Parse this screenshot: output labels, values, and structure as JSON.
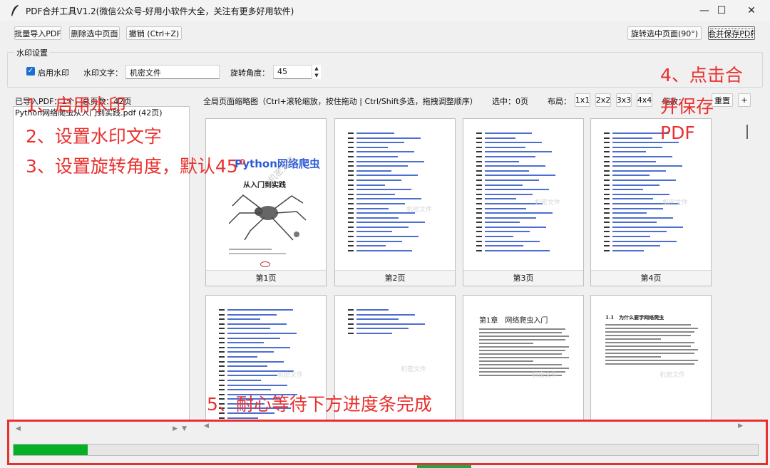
{
  "window": {
    "title": "PDF合并工具V1.2(微信公众号-好用小软件大全，关注有更多好用软件)",
    "minimize": "—",
    "maximize": "☐",
    "close": "✕"
  },
  "toolbar": {
    "import": "批量导入PDF",
    "delete": "删除选中页面",
    "undo": "撤销 (Ctrl+Z)",
    "rotate": "旋转选中页面(90°)",
    "merge_save": "合并保存PDF"
  },
  "watermark": {
    "group_title": "水印设置",
    "enable_label": "启用水印",
    "enabled": true,
    "text_label": "水印文字：",
    "text_value": "机密文件",
    "angle_label": "旋转角度：",
    "angle_value": "45"
  },
  "files": {
    "summary": "已导入PDF：1个，总页数：42页",
    "items": [
      "Python网络爬虫从入门到实践.pdf (42页)"
    ]
  },
  "preview": {
    "hint": "全局页面缩略图（Ctrl+滚轮缩放，按住拖动 | Ctrl/Shift多选，拖拽调整顺序）",
    "selected": "选中：0页",
    "layout_label": "布局：",
    "layouts": [
      "1x1",
      "2x2",
      "3x3",
      "4x4"
    ],
    "zoom_label": "缩放：",
    "zoom_reset": "重置",
    "zoom_plus": "+",
    "pages": [
      "第1页",
      "第2页",
      "第3页",
      "第4页"
    ],
    "cover_title": "Python网络爬虫",
    "cover_subtitle": "从入门到实践",
    "watermark_text": "机密文件",
    "chapter_title": "第1章　网络爬虫入门",
    "section_title": "1.1　为什么要学网络爬虫"
  },
  "progress": {
    "value": 0.1
  },
  "annotations": {
    "a1": "1、启用水印",
    "a2": "2、设置水印文字",
    "a3": "3、设置旋转角度，默认45°",
    "a4_line1": "4、点击合",
    "a4_line2": "并保存",
    "a4_line3": "PDF",
    "a5": "5、耐心等待下方进度条完成"
  },
  "colors": {
    "accent": "#1a6fd0",
    "progress": "#06b025",
    "annotation": "#e8312f",
    "toc_link": "#2e55c8"
  }
}
